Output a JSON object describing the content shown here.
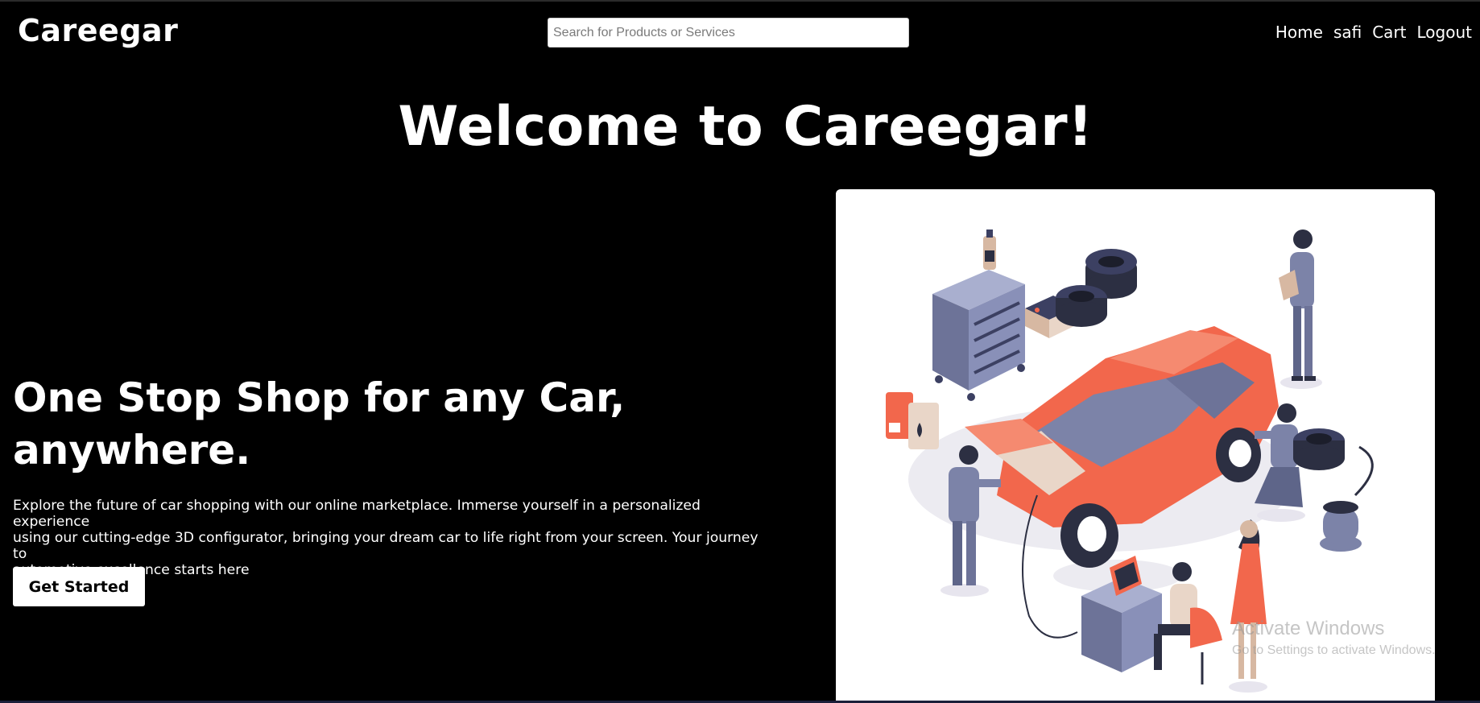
{
  "header": {
    "brand": "Careegar",
    "search_placeholder": "Search for Products or Services",
    "nav": [
      {
        "label": "Home"
      },
      {
        "label": "safi"
      },
      {
        "label": "Cart"
      },
      {
        "label": "Logout"
      }
    ]
  },
  "main": {
    "welcome": "Welcome to Careegar!",
    "hero_title_line1": "One Stop Shop for any Car,",
    "hero_title_line2": "anywhere.",
    "hero_text_line1": "Explore the future of car shopping with our online marketplace. Immerse yourself in a personalized experience",
    "hero_text_line2": "using our cutting-edge 3D configurator, bringing your dream car to life right from your screen. Your journey to",
    "hero_text_line3": "automotive excellence starts here",
    "cta_label": "Get Started",
    "illustration": "car-repair-workshop-illustration"
  },
  "watermark": {
    "title": "Activate Windows",
    "subtitle": "Go to Settings to activate Windows."
  },
  "colors": {
    "background": "#000000",
    "text": "#ffffff",
    "car": "#f2674c",
    "tool_cabinet": "#7c83a8",
    "tire": "#2c2f42"
  }
}
